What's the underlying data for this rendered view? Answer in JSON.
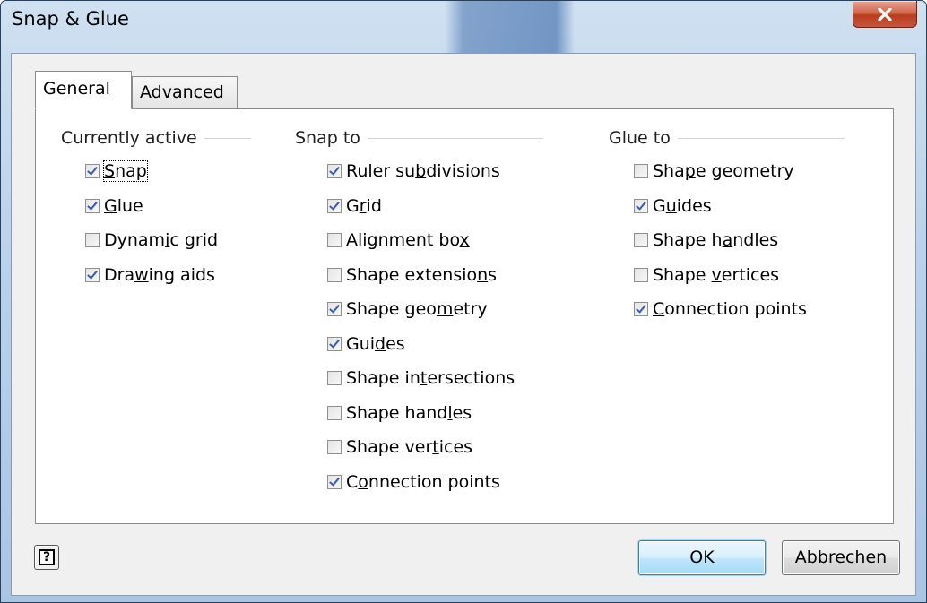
{
  "window": {
    "title": "Snap & Glue",
    "close_icon": "close-x-icon"
  },
  "tabs": [
    {
      "label": "General",
      "active": true
    },
    {
      "label": "Advanced",
      "active": false
    }
  ],
  "groups": {
    "currently_active": {
      "title": "Currently active",
      "items": [
        {
          "pre": "",
          "key": "S",
          "post": "nap",
          "checked": true
        },
        {
          "pre": "",
          "key": "G",
          "post": "lue",
          "checked": true
        },
        {
          "pre": "Dynam",
          "key": "i",
          "post": "c grid",
          "checked": false
        },
        {
          "pre": "Dra",
          "key": "w",
          "post": "ing aids",
          "checked": true
        }
      ]
    },
    "snap_to": {
      "title": "Snap to",
      "items": [
        {
          "pre": "Ruler su",
          "key": "b",
          "post": "divisions",
          "checked": true
        },
        {
          "pre": "G",
          "key": "r",
          "post": "id",
          "checked": true
        },
        {
          "pre": "Alignment bo",
          "key": "x",
          "post": "",
          "checked": false
        },
        {
          "pre": "Shape extensio",
          "key": "n",
          "post": "s",
          "checked": false
        },
        {
          "pre": "Shape geo",
          "key": "m",
          "post": "etry",
          "checked": true
        },
        {
          "pre": "Gui",
          "key": "d",
          "post": "es",
          "checked": true
        },
        {
          "pre": "Shape in",
          "key": "t",
          "post": "ersections",
          "checked": false
        },
        {
          "pre": "Shape hand",
          "key": "l",
          "post": "es",
          "checked": false
        },
        {
          "pre": "Shape ver",
          "key": "t",
          "post": "ices",
          "checked": false
        },
        {
          "pre": "C",
          "key": "o",
          "post": "nnection points",
          "checked": true
        }
      ]
    },
    "glue_to": {
      "title": "Glue to",
      "items": [
        {
          "pre": "Sha",
          "key": "p",
          "post": "e geometry",
          "checked": false
        },
        {
          "pre": "G",
          "key": "u",
          "post": "ides",
          "checked": true
        },
        {
          "pre": "Shape h",
          "key": "a",
          "post": "ndles",
          "checked": false
        },
        {
          "pre": "Shape ",
          "key": "v",
          "post": "ertices",
          "checked": false
        },
        {
          "pre": "",
          "key": "C",
          "post": "onnection points",
          "checked": true
        }
      ]
    }
  },
  "buttons": {
    "help_icon": "help-question-icon",
    "help_glyph": "?",
    "ok": "OK",
    "cancel": "Abbrechen"
  }
}
